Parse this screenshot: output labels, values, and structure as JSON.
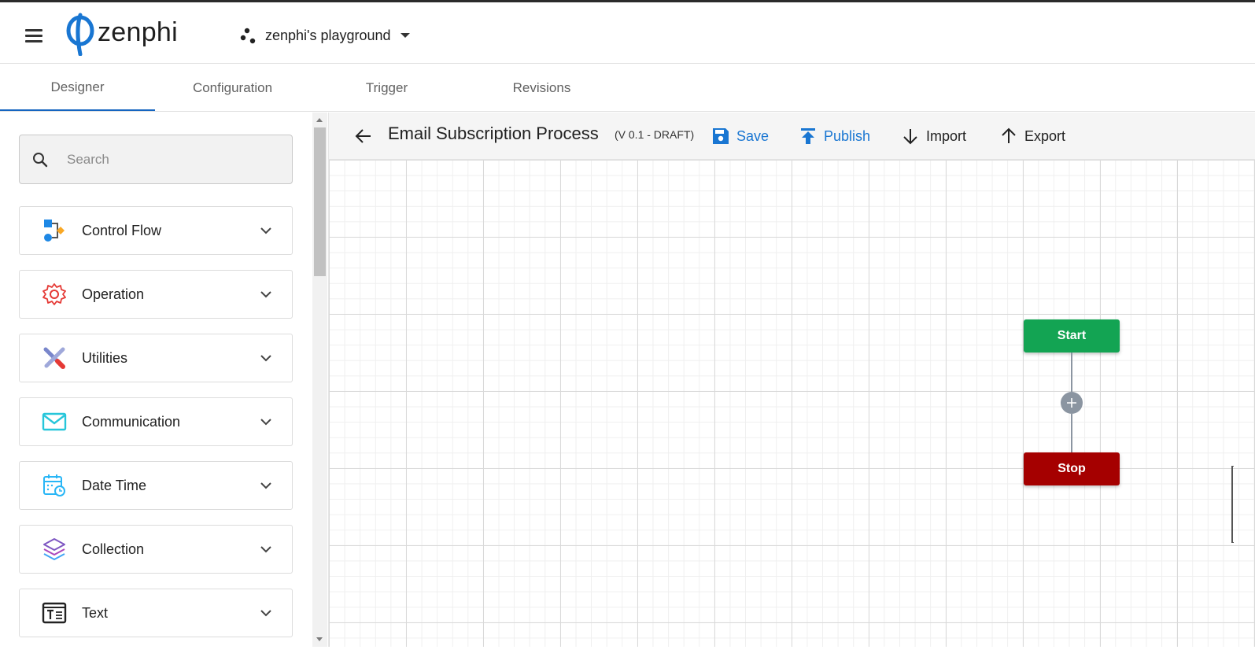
{
  "app": {
    "logo_text": "zenphi",
    "workspace": "zenphi's playground"
  },
  "tabs": [
    {
      "label": "Designer",
      "active": true
    },
    {
      "label": "Configuration",
      "active": false
    },
    {
      "label": "Trigger",
      "active": false
    },
    {
      "label": "Revisions",
      "active": false
    }
  ],
  "sidebar": {
    "search_placeholder": "Search",
    "categories": [
      {
        "label": "Control Flow",
        "icon": "control-flow-icon"
      },
      {
        "label": "Operation",
        "icon": "gear-icon"
      },
      {
        "label": "Utilities",
        "icon": "tools-icon"
      },
      {
        "label": "Communication",
        "icon": "envelope-icon"
      },
      {
        "label": "Date Time",
        "icon": "calendar-clock-icon"
      },
      {
        "label": "Collection",
        "icon": "layers-icon"
      },
      {
        "label": "Text",
        "icon": "text-box-icon"
      }
    ]
  },
  "toolbar": {
    "title": "Email Subscription Process",
    "version": "(V 0.1 - DRAFT)",
    "save": "Save",
    "publish": "Publish",
    "import": "Import",
    "export": "Export"
  },
  "flow": {
    "start_label": "Start",
    "stop_label": "Stop",
    "start_color": "#13a453",
    "stop_color": "#a50000"
  },
  "colors": {
    "accent": "#1976d2",
    "tab_indicator": "#1565c0"
  }
}
